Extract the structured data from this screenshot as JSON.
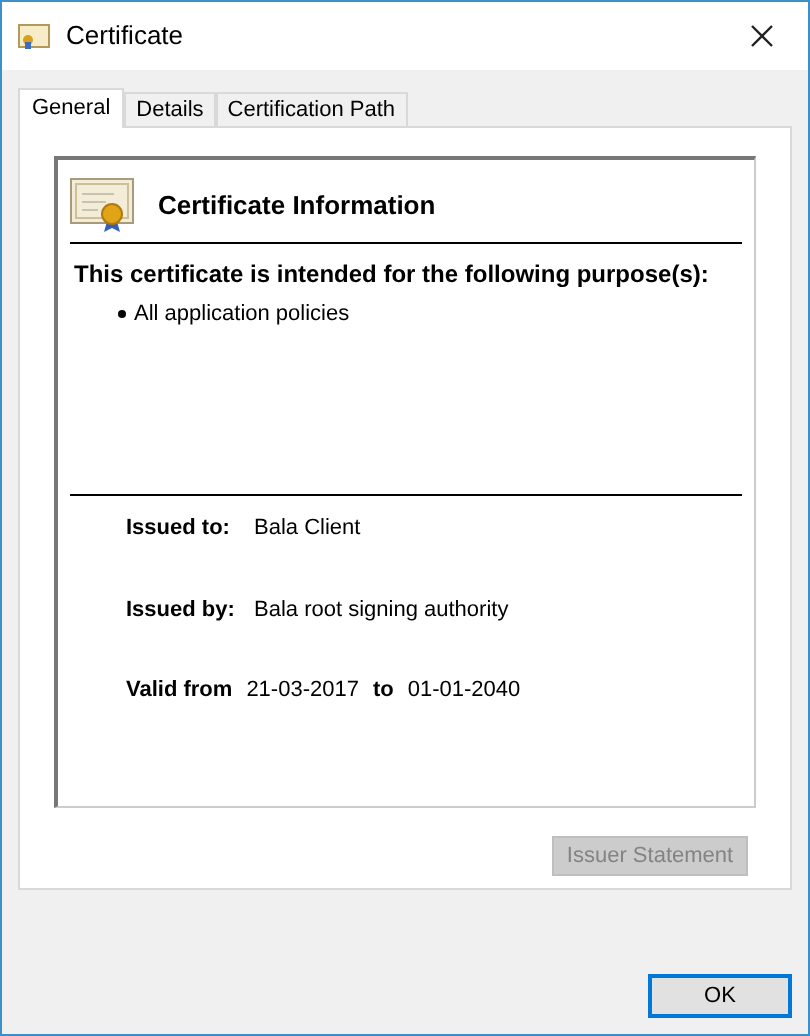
{
  "window": {
    "title": "Certificate"
  },
  "tabs": [
    {
      "label": "General",
      "selected": true
    },
    {
      "label": "Details",
      "selected": false
    },
    {
      "label": "Certification Path",
      "selected": false
    }
  ],
  "info": {
    "heading": "Certificate Information",
    "purpose_title": "This certificate is intended for the following purpose(s):",
    "purposes": [
      "All application policies"
    ],
    "issued_to": {
      "label": "Issued to:",
      "value": "Bala Client"
    },
    "issued_by": {
      "label": "Issued by:",
      "value": "Bala root signing authority"
    },
    "validity": {
      "label": "Valid from",
      "from": "21-03-2017",
      "to_label": "to",
      "to": "01-01-2040"
    }
  },
  "issuer_statement": {
    "label": "Issuer Statement",
    "disabled": true
  },
  "ok": {
    "label": "OK"
  }
}
